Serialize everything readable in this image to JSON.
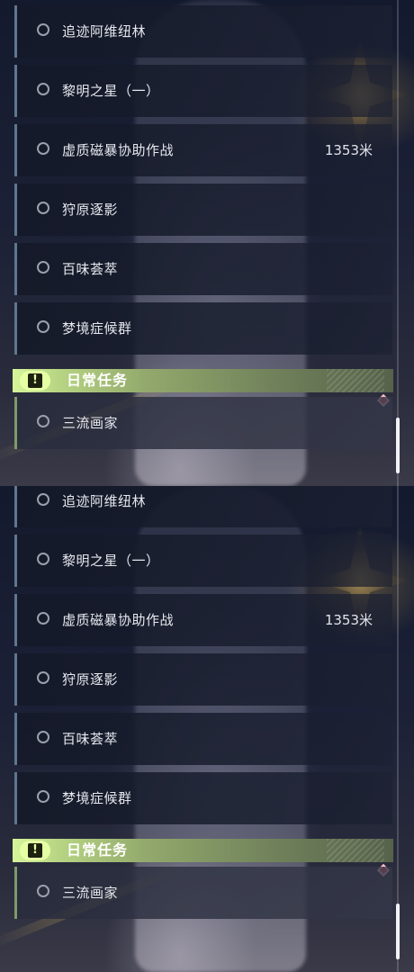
{
  "quests": [
    {
      "name": "追迹阿维纽林",
      "distance": ""
    },
    {
      "name": "黎明之星（一）",
      "distance": ""
    },
    {
      "name": "虚质磁暴协助作战",
      "distance": "1353米"
    },
    {
      "name": "狩原逐影",
      "distance": ""
    },
    {
      "name": "百味荟萃",
      "distance": ""
    },
    {
      "name": "梦境症候群",
      "distance": ""
    }
  ],
  "daily_section": {
    "title": "日常任务",
    "icon": "exclamation-icon",
    "quests": [
      {
        "name": "三流画家"
      }
    ]
  },
  "icons": {
    "quest_status": "radio-circle-icon",
    "waypoint": "diamond-marker-icon"
  },
  "colors": {
    "section_accent": "#d6f59a",
    "marker": "#e0566a",
    "row_border": "#5f7690",
    "daily_border": "#7e9a68"
  }
}
